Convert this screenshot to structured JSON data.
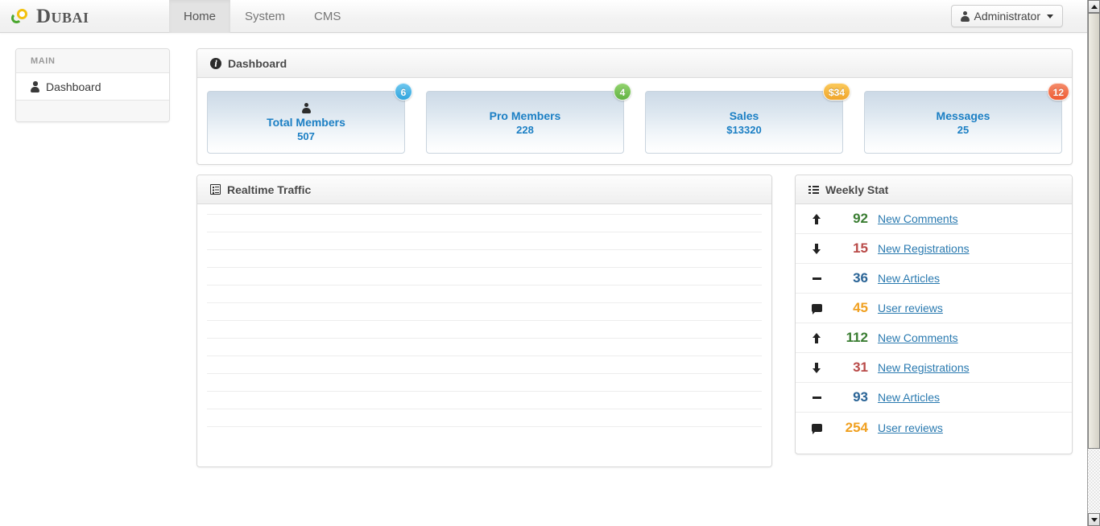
{
  "navbar": {
    "brand": "Dubai",
    "brand_icon": "two-rings-logo",
    "tabs": [
      {
        "label": "Home",
        "active": true
      },
      {
        "label": "System",
        "active": false
      },
      {
        "label": "CMS",
        "active": false
      }
    ],
    "user_menu": {
      "label": "Administrator",
      "icon": "person-icon",
      "caret": "chevron-down-icon"
    }
  },
  "sidebar": {
    "header": "MAIN",
    "items": [
      {
        "label": "Dashboard",
        "icon": "person-icon"
      }
    ]
  },
  "dashboard": {
    "title": "Dashboard",
    "icon": "info-circle-icon",
    "cards": [
      {
        "label": "Total Members",
        "value": "507",
        "badge": "6",
        "badge_color": "#32a5dd",
        "badge_style": "badge-blue",
        "icon": "person-icon",
        "has_icon": true
      },
      {
        "label": "Pro Members",
        "value": "228",
        "badge": "4",
        "badge_color": "#62b343",
        "badge_style": "badge-green",
        "icon": "",
        "has_icon": false
      },
      {
        "label": "Sales",
        "value": "$13320",
        "badge": "$34",
        "badge_color": "#f0a52b",
        "badge_style": "badge-orange",
        "icon": "",
        "has_icon": false
      },
      {
        "label": "Messages",
        "value": "25",
        "badge": "12",
        "badge_color": "#ef5b33",
        "badge_style": "badge-red",
        "icon": "",
        "has_icon": false
      }
    ]
  },
  "traffic": {
    "title": "Realtime Traffic",
    "icon": "table-list-icon",
    "chart_data": {
      "type": "line",
      "title": "Realtime Traffic",
      "series": [],
      "x": [],
      "categories": [],
      "values": [],
      "xlabel": "",
      "ylabel": "",
      "grid": true,
      "gridline_count": 13,
      "legend": "none",
      "note": "Empty chart area — horizontal gridlines only, no plotted data"
    }
  },
  "weekly": {
    "title": "Weekly Stat",
    "icon": "list-ul-icon",
    "rows": [
      {
        "icon": "arrow-up-icon",
        "icon_name": "arrow-up-icon",
        "value": "92",
        "color_class": "num-green",
        "color": "#3a7d32",
        "label": "New Comments"
      },
      {
        "icon": "arrow-down-icon",
        "icon_name": "arrow-down-icon",
        "value": "15",
        "color_class": "num-red",
        "color": "#b94a48",
        "label": "New Registrations"
      },
      {
        "icon": "minus-icon",
        "icon_name": "minus-icon",
        "value": "36",
        "color_class": "num-blue",
        "color": "#2a6496",
        "label": "New Articles"
      },
      {
        "icon": "comment-icon",
        "icon_name": "comment-icon",
        "value": "45",
        "color_class": "num-orange",
        "color": "#f0a020",
        "label": "User reviews"
      },
      {
        "icon": "arrow-up-icon",
        "icon_name": "arrow-up-icon",
        "value": "112",
        "color_class": "num-green",
        "color": "#3a7d32",
        "label": "New Comments"
      },
      {
        "icon": "arrow-down-icon",
        "icon_name": "arrow-down-icon",
        "value": "31",
        "color_class": "num-red",
        "color": "#b94a48",
        "label": "New Registrations"
      },
      {
        "icon": "minus-icon",
        "icon_name": "minus-icon",
        "value": "93",
        "color_class": "num-blue",
        "color": "#2a6496",
        "label": "New Articles"
      },
      {
        "icon": "comment-icon",
        "icon_name": "comment-icon",
        "value": "254",
        "color_class": "num-orange",
        "color": "#f0a020",
        "label": "User reviews"
      }
    ]
  },
  "scrollbar": {
    "up_arrow": "scroll-up-icon",
    "down_arrow": "scroll-down-icon"
  }
}
